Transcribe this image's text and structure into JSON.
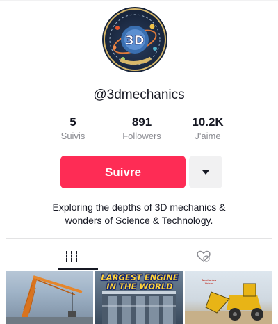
{
  "profile": {
    "handle": "@3dmechanics",
    "avatar_text": "3D",
    "avatar_icon": "3d-mechanics-logo-icon"
  },
  "stats": [
    {
      "value": "5",
      "label": "Suivis"
    },
    {
      "value": "891",
      "label": "Followers"
    },
    {
      "value": "10.2K",
      "label": "J'aime"
    }
  ],
  "actions": {
    "follow_label": "Suivre",
    "more_icon": "caret-down-icon"
  },
  "bio": {
    "line1": "Exploring the depths of 3D mechanics &",
    "line2": "wonders of Science & Technology."
  },
  "tabs": [
    {
      "icon": "videos-grid-icon",
      "selected": true
    },
    {
      "icon": "liked-heart-hidden-icon",
      "selected": false
    }
  ],
  "videos": [
    {
      "title": "",
      "icon": "crane-thumbnail"
    },
    {
      "title_line1": "LARGEST ENGINE",
      "title_line2": "IN THE WORLD",
      "icon": "engine-thumbnail"
    },
    {
      "title": "",
      "tiny_line1": "Mechanics",
      "tiny_line2": "Voices",
      "icon": "loader-thumbnail"
    }
  ],
  "colors": {
    "accent": "#fe2c55",
    "text": "#161823",
    "muted": "#8a8b91",
    "button_secondary": "#f1f1f2"
  }
}
